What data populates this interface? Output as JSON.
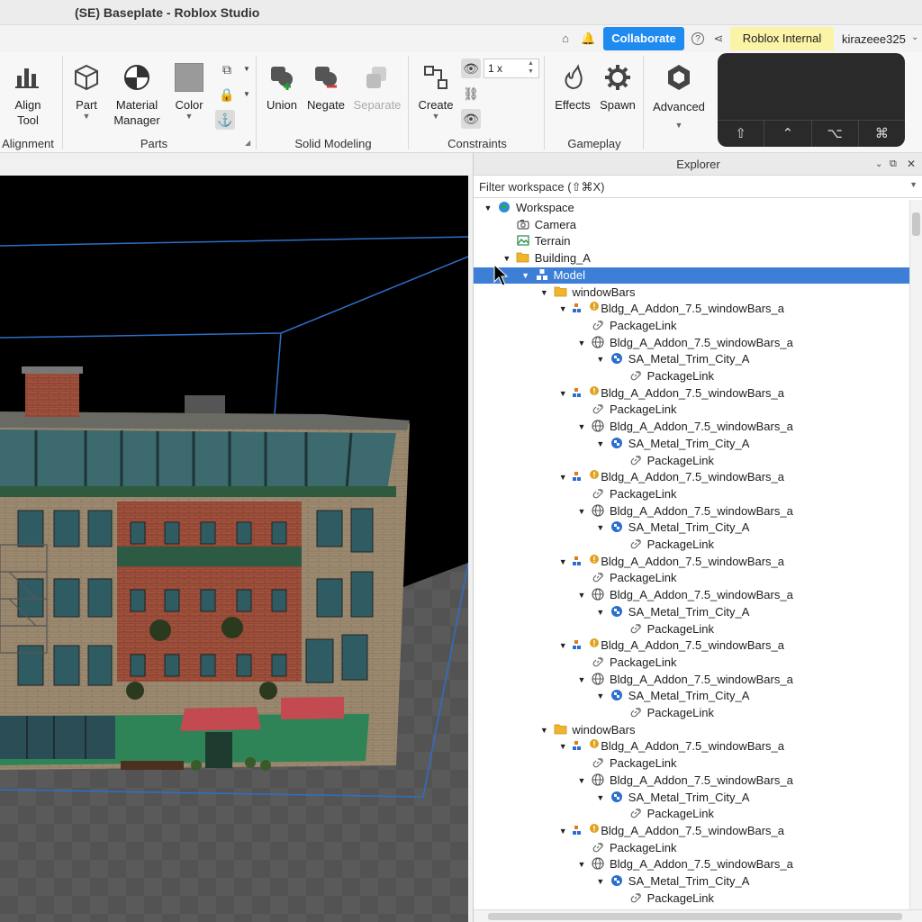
{
  "window": {
    "title": "(SE) Baseplate - Roblox Studio"
  },
  "topbar": {
    "collaborate_label": "Collaborate",
    "badge_label": "Roblox Internal",
    "username": "kirazeee325"
  },
  "ribbon": {
    "align_tool": "Align\nTool",
    "alignment_group": "Alignment",
    "part": "Part",
    "material_manager": "Material\nManager",
    "color": "Color",
    "parts_group": "Parts",
    "union": "Union",
    "negate": "Negate",
    "separate": "Separate",
    "solid_modeling_group": "Solid Modeling",
    "create": "Create",
    "scale_value": "1 x",
    "constraints_group": "Constraints",
    "effects": "Effects",
    "spawn": "Spawn",
    "gameplay_group": "Gameplay",
    "advanced": "Advanced",
    "color_swatch": "#9a9a9a"
  },
  "explorer": {
    "title": "Explorer",
    "filter_placeholder": "Filter workspace (⇧⌘X)",
    "rows": [
      {
        "label": "Workspace",
        "depth": 0,
        "arrow": "▼",
        "icon": "globe-icon"
      },
      {
        "label": "Camera",
        "depth": 1,
        "arrow": "",
        "icon": "camera-icon"
      },
      {
        "label": "Terrain",
        "depth": 1,
        "arrow": "",
        "icon": "terrain-icon"
      },
      {
        "label": "Building_A",
        "depth": 1,
        "arrow": "▼",
        "icon": "folder-icon"
      },
      {
        "label": "Model",
        "depth": 2,
        "arrow": "▼",
        "icon": "model-icon",
        "selected": true
      },
      {
        "label": "windowBars",
        "depth": 3,
        "arrow": "▼",
        "icon": "folder-icon"
      },
      {
        "label": "Bldg_A_Addon_7.5_windowBars_a",
        "depth": 4,
        "arrow": "▼",
        "icon": "package-warning-icon"
      },
      {
        "label": "PackageLink",
        "depth": 5,
        "arrow": "",
        "icon": "link-icon"
      },
      {
        "label": "Bldg_A_Addon_7.5_windowBars_a",
        "depth": 5,
        "arrow": "▼",
        "icon": "mesh-icon"
      },
      {
        "label": "SA_Metal_Trim_City_A",
        "depth": 6,
        "arrow": "▼",
        "icon": "material-icon"
      },
      {
        "label": "PackageLink",
        "depth": 7,
        "arrow": "",
        "icon": "link-icon"
      },
      {
        "label": "Bldg_A_Addon_7.5_windowBars_a",
        "depth": 4,
        "arrow": "▼",
        "icon": "package-warning-icon"
      },
      {
        "label": "PackageLink",
        "depth": 5,
        "arrow": "",
        "icon": "link-icon"
      },
      {
        "label": "Bldg_A_Addon_7.5_windowBars_a",
        "depth": 5,
        "arrow": "▼",
        "icon": "mesh-icon"
      },
      {
        "label": "SA_Metal_Trim_City_A",
        "depth": 6,
        "arrow": "▼",
        "icon": "material-icon"
      },
      {
        "label": "PackageLink",
        "depth": 7,
        "arrow": "",
        "icon": "link-icon"
      },
      {
        "label": "Bldg_A_Addon_7.5_windowBars_a",
        "depth": 4,
        "arrow": "▼",
        "icon": "package-warning-icon"
      },
      {
        "label": "PackageLink",
        "depth": 5,
        "arrow": "",
        "icon": "link-icon"
      },
      {
        "label": "Bldg_A_Addon_7.5_windowBars_a",
        "depth": 5,
        "arrow": "▼",
        "icon": "mesh-icon"
      },
      {
        "label": "SA_Metal_Trim_City_A",
        "depth": 6,
        "arrow": "▼",
        "icon": "material-icon"
      },
      {
        "label": "PackageLink",
        "depth": 7,
        "arrow": "",
        "icon": "link-icon"
      },
      {
        "label": "Bldg_A_Addon_7.5_windowBars_a",
        "depth": 4,
        "arrow": "▼",
        "icon": "package-warning-icon"
      },
      {
        "label": "PackageLink",
        "depth": 5,
        "arrow": "",
        "icon": "link-icon"
      },
      {
        "label": "Bldg_A_Addon_7.5_windowBars_a",
        "depth": 5,
        "arrow": "▼",
        "icon": "mesh-icon"
      },
      {
        "label": "SA_Metal_Trim_City_A",
        "depth": 6,
        "arrow": "▼",
        "icon": "material-icon"
      },
      {
        "label": "PackageLink",
        "depth": 7,
        "arrow": "",
        "icon": "link-icon"
      },
      {
        "label": "Bldg_A_Addon_7.5_windowBars_a",
        "depth": 4,
        "arrow": "▼",
        "icon": "package-warning-icon"
      },
      {
        "label": "PackageLink",
        "depth": 5,
        "arrow": "",
        "icon": "link-icon"
      },
      {
        "label": "Bldg_A_Addon_7.5_windowBars_a",
        "depth": 5,
        "arrow": "▼",
        "icon": "mesh-icon"
      },
      {
        "label": "SA_Metal_Trim_City_A",
        "depth": 6,
        "arrow": "▼",
        "icon": "material-icon"
      },
      {
        "label": "PackageLink",
        "depth": 7,
        "arrow": "",
        "icon": "link-icon"
      },
      {
        "label": "windowBars",
        "depth": 3,
        "arrow": "▼",
        "icon": "folder-icon"
      },
      {
        "label": "Bldg_A_Addon_7.5_windowBars_a",
        "depth": 4,
        "arrow": "▼",
        "icon": "package-warning-icon"
      },
      {
        "label": "PackageLink",
        "depth": 5,
        "arrow": "",
        "icon": "link-icon"
      },
      {
        "label": "Bldg_A_Addon_7.5_windowBars_a",
        "depth": 5,
        "arrow": "▼",
        "icon": "mesh-icon"
      },
      {
        "label": "SA_Metal_Trim_City_A",
        "depth": 6,
        "arrow": "▼",
        "icon": "material-icon"
      },
      {
        "label": "PackageLink",
        "depth": 7,
        "arrow": "",
        "icon": "link-icon"
      },
      {
        "label": "Bldg_A_Addon_7.5_windowBars_a",
        "depth": 4,
        "arrow": "▼",
        "icon": "package-warning-icon"
      },
      {
        "label": "PackageLink",
        "depth": 5,
        "arrow": "",
        "icon": "link-icon"
      },
      {
        "label": "Bldg_A_Addon_7.5_windowBars_a",
        "depth": 5,
        "arrow": "▼",
        "icon": "mesh-icon"
      },
      {
        "label": "SA_Metal_Trim_City_A",
        "depth": 6,
        "arrow": "▼",
        "icon": "material-icon"
      },
      {
        "label": "PackageLink",
        "depth": 7,
        "arrow": "",
        "icon": "link-icon"
      }
    ]
  }
}
